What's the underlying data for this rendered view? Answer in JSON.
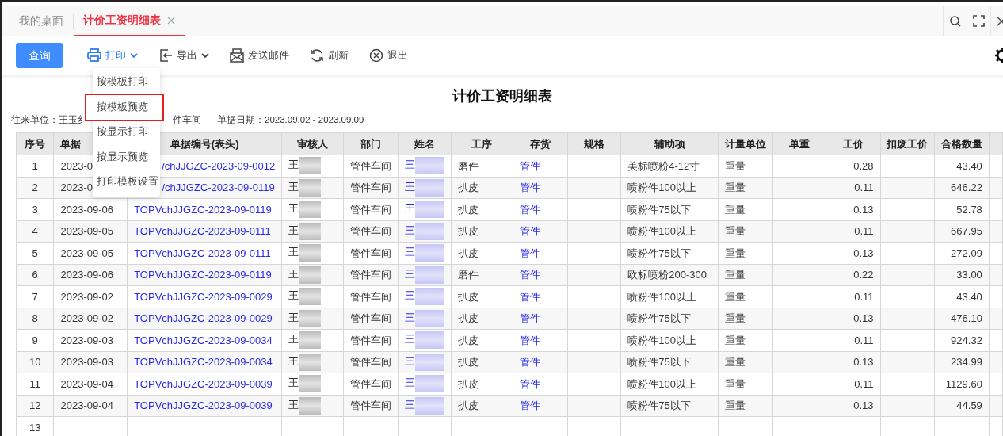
{
  "tabs": [
    {
      "label": "我的桌面",
      "selected": false,
      "closable": false
    },
    {
      "label": "计价工资明细表",
      "selected": true,
      "closable": true
    }
  ],
  "toolbar": [
    {
      "kind": "primary",
      "label": "查询"
    },
    {
      "kind": "print",
      "label": "打印",
      "dropdown": true,
      "open": true
    },
    {
      "kind": "export",
      "label": "导出",
      "dropdown": true,
      "open": false
    },
    {
      "kind": "mail",
      "label": "发送邮件"
    },
    {
      "kind": "refresh",
      "label": "刷新"
    },
    {
      "kind": "exit",
      "label": "退出"
    }
  ],
  "print_menu": [
    {
      "label": "按模板打印",
      "highlighted": false
    },
    {
      "label": "按模板预览",
      "highlighted": true
    },
    {
      "label": "按显示打印",
      "highlighted": false
    },
    {
      "label": "按显示预览",
      "highlighted": false
    },
    {
      "label": "打印模板设置",
      "highlighted": false
    }
  ],
  "report": {
    "title": "计价工资明细表",
    "partner_label": "往来单位：王玉纟",
    "department_fragment": "件车间",
    "date_label": "单据日期：2023.09.02 - 2023.09.09"
  },
  "table": {
    "columns": [
      "序号",
      "单据",
      "单据编号(表头)",
      "审核人",
      "部门",
      "姓名",
      "工序",
      "存货",
      "规格",
      "辅助项",
      "计量单位",
      "单重",
      "工价",
      "扣废工价",
      "合格数量"
    ],
    "rows": [
      {
        "seq": "1",
        "date": "2023-0",
        "doc_no": "/chJJGZC-2023-09-0012",
        "reviewer": "王",
        "dept": "管件车间",
        "name": "三",
        "process": "磨件",
        "stock": "管件",
        "aux": "美标喷粉4-12寸",
        "unit": "重量",
        "price": "0.28",
        "qty": "43.40"
      },
      {
        "seq": "2",
        "date": "2023-0",
        "doc_no": "/chJJGZC-2023-09-0119",
        "reviewer": "王",
        "dept": "管件车间",
        "name": "王",
        "process": "扒皮",
        "stock": "管件",
        "aux": "喷粉件100以上",
        "unit": "重量",
        "price": "0.11",
        "qty": "646.22"
      },
      {
        "seq": "3",
        "date": "2023-09-06",
        "doc_no": "TOPVchJJGZC-2023-09-0119",
        "reviewer": "王",
        "dept": "管件车间",
        "name": "王",
        "process": "扒皮",
        "stock": "管件",
        "aux": "喷粉件75以下",
        "unit": "重量",
        "price": "0.13",
        "qty": "52.78"
      },
      {
        "seq": "4",
        "date": "2023-09-05",
        "doc_no": "TOPVchJJGZC-2023-09-0111",
        "reviewer": "王",
        "dept": "管件车间",
        "name": "三",
        "process": "扒皮",
        "stock": "管件",
        "aux": "喷粉件100以上",
        "unit": "重量",
        "price": "0.11",
        "qty": "667.95"
      },
      {
        "seq": "5",
        "date": "2023-09-05",
        "doc_no": "TOPVchJJGZC-2023-09-0111",
        "reviewer": "王",
        "dept": "管件车间",
        "name": "三",
        "process": "扒皮",
        "stock": "管件",
        "aux": "喷粉件75以下",
        "unit": "重量",
        "price": "0.13",
        "qty": "272.09"
      },
      {
        "seq": "6",
        "date": "2023-09-06",
        "doc_no": "TOPVchJJGZC-2023-09-0119",
        "reviewer": "王",
        "dept": "管件车间",
        "name": "三",
        "process": "磨件",
        "stock": "管件",
        "aux": "欧标喷粉200-300",
        "unit": "重量",
        "price": "0.22",
        "qty": "33.00"
      },
      {
        "seq": "7",
        "date": "2023-09-02",
        "doc_no": "TOPVchJJGZC-2023-09-0029",
        "reviewer": "王",
        "dept": "管件车间",
        "name": "三",
        "process": "扒皮",
        "stock": "管件",
        "aux": "喷粉件100以上",
        "unit": "重量",
        "price": "0.11",
        "qty": "43.40"
      },
      {
        "seq": "8",
        "date": "2023-09-02",
        "doc_no": "TOPVchJJGZC-2023-09-0029",
        "reviewer": "王",
        "dept": "管件车间",
        "name": "三",
        "process": "扒皮",
        "stock": "管件",
        "aux": "喷粉件75以下",
        "unit": "重量",
        "price": "0.13",
        "qty": "476.10"
      },
      {
        "seq": "9",
        "date": "2023-09-03",
        "doc_no": "TOPVchJJGZC-2023-09-0034",
        "reviewer": "王",
        "dept": "管件车间",
        "name": "三",
        "process": "扒皮",
        "stock": "管件",
        "aux": "喷粉件100以上",
        "unit": "重量",
        "price": "0.11",
        "qty": "924.32"
      },
      {
        "seq": "10",
        "date": "2023-09-03",
        "doc_no": "TOPVchJJGZC-2023-09-0034",
        "reviewer": "王",
        "dept": "管件车间",
        "name": "三",
        "process": "扒皮",
        "stock": "管件",
        "aux": "喷粉件75以下",
        "unit": "重量",
        "price": "0.13",
        "qty": "234.99"
      },
      {
        "seq": "11",
        "date": "2023-09-04",
        "doc_no": "TOPVchJJGZC-2023-09-0039",
        "reviewer": "王",
        "dept": "管件车间",
        "name": "三",
        "process": "扒皮",
        "stock": "管件",
        "aux": "喷粉件100以上",
        "unit": "重量",
        "price": "0.11",
        "qty": "1129.60"
      },
      {
        "seq": "12",
        "date": "2023-09-04",
        "doc_no": "TOPVchJJGZC-2023-09-0039",
        "reviewer": "王",
        "dept": "管件车间",
        "name": "三",
        "process": "扒皮",
        "stock": "管件",
        "aux": "喷粉件75以下",
        "unit": "重量",
        "price": "0.13",
        "qty": "44.59"
      },
      {
        "seq": "13"
      }
    ]
  }
}
